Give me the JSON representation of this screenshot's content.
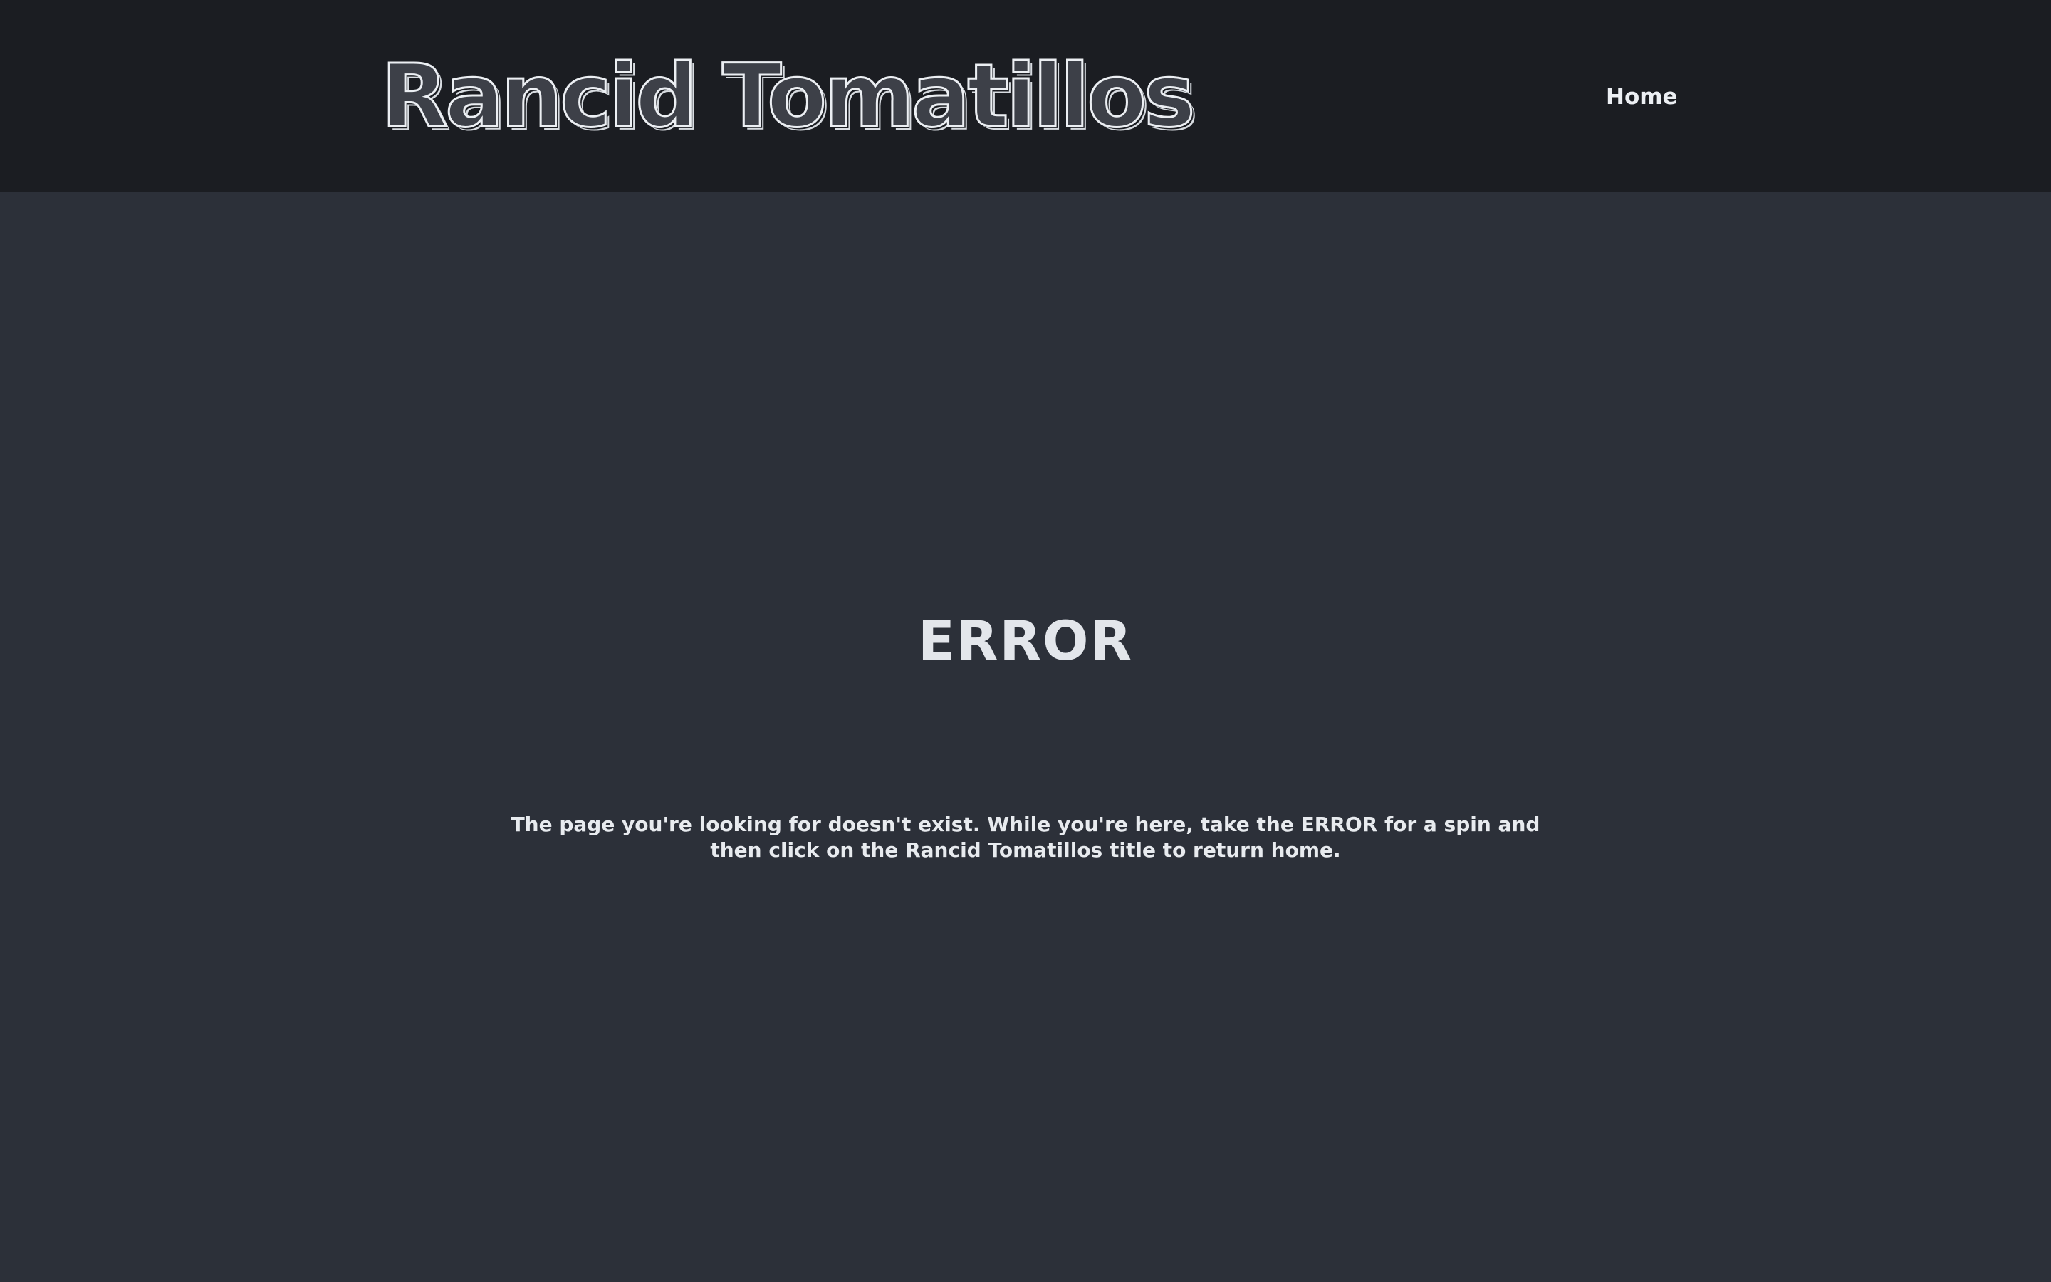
{
  "header": {
    "site_title": "Rancid Tomatillos",
    "nav": {
      "home_label": "Home"
    }
  },
  "main": {
    "error_heading": "ERROR",
    "error_message": "The page you're looking for doesn't exist. While you're here, take the ERROR for a spin and then click on the Rancid Tomatillos title to return home."
  },
  "colors": {
    "header_background": "#1b1d22",
    "page_background": "#2c3039",
    "text": "#e3e6eb"
  }
}
